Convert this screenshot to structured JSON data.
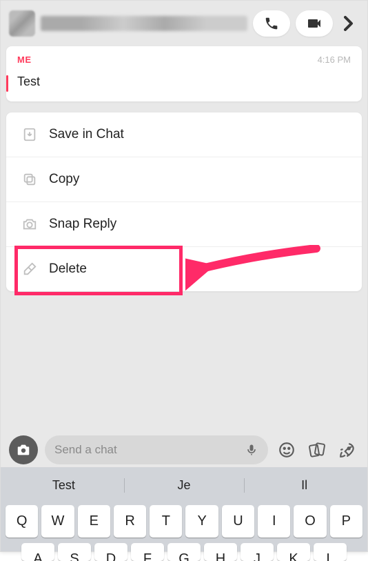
{
  "header": {
    "call_label": "voice-call",
    "video_label": "video-call"
  },
  "message": {
    "sender": "ME",
    "time": "4:16 PM",
    "text": "Test"
  },
  "menu": {
    "save": "Save in Chat",
    "copy": "Copy",
    "snap_reply": "Snap Reply",
    "delete": "Delete"
  },
  "chatbar": {
    "placeholder": "Send a chat"
  },
  "suggestions": [
    "Test",
    "Je",
    "Il"
  ],
  "keyboard_row1": [
    "Q",
    "W",
    "E",
    "R",
    "T",
    "Y",
    "U",
    "I",
    "O",
    "P"
  ],
  "keyboard_row2": [
    "A",
    "S",
    "D",
    "F",
    "G",
    "H",
    "J",
    "K",
    "L"
  ]
}
